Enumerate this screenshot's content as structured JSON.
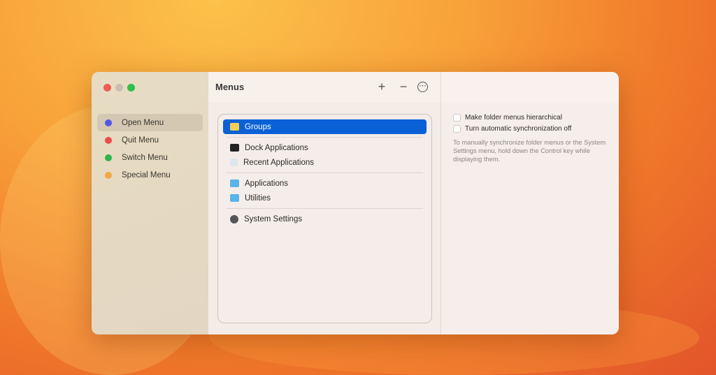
{
  "sidebar": {
    "items": [
      {
        "label": "Open Menu",
        "color": "#5457e8",
        "selected": true
      },
      {
        "label": "Quit Menu",
        "color": "#ec4c4c"
      },
      {
        "label": "Switch Menu",
        "color": "#2cb54c"
      },
      {
        "label": "Special Menu",
        "color": "#f3a848"
      }
    ]
  },
  "header": {
    "title": "Menus",
    "add": "+",
    "remove": "−",
    "more": "⋯"
  },
  "list": {
    "groups": "Groups",
    "dock": "Dock Applications",
    "recent": "Recent Applications",
    "applications": "Applications",
    "utilities": "Utilities",
    "settings": "System Settings"
  },
  "options": {
    "hierarchical": "Make folder menus hierarchical",
    "sync_off": "Turn automatic synchronization off",
    "help": "To manually synchronize folder menus or the System Settings menu, hold down the Control key while displaying them."
  }
}
